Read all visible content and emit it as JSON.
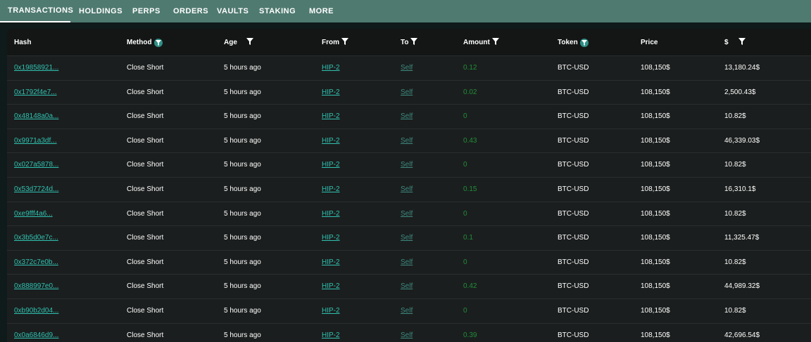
{
  "tabs": [
    {
      "label": "TRANSACTIONS",
      "active": true
    },
    {
      "label": "HOLDINGS",
      "active": false
    },
    {
      "label": "PERPS",
      "active": false
    },
    {
      "label": "ORDERS",
      "active": false
    },
    {
      "label": "VAULTS",
      "active": false
    },
    {
      "label": "STAKING",
      "active": false
    },
    {
      "label": "MORE",
      "active": false
    }
  ],
  "columns": {
    "hash": "Hash",
    "method": "Method",
    "age": "Age",
    "from": "From",
    "to": "To",
    "amount": "Amount",
    "token": "Token",
    "price": "Price",
    "usd": "$"
  },
  "rows": [
    {
      "hash": "0x19858921...",
      "method": "Close Short",
      "age": "5 hours ago",
      "from": "HIP-2",
      "to": "Self",
      "amount": "0.12",
      "token": "BTC-USD",
      "price": "108,150$",
      "usd": "13,180.24$"
    },
    {
      "hash": "0x1792f4e7...",
      "method": "Close Short",
      "age": "5 hours ago",
      "from": "HIP-2",
      "to": "Self",
      "amount": "0.02",
      "token": "BTC-USD",
      "price": "108,150$",
      "usd": "2,500.43$"
    },
    {
      "hash": "0x48148a0a...",
      "method": "Close Short",
      "age": "5 hours ago",
      "from": "HIP-2",
      "to": "Self",
      "amount": "0",
      "token": "BTC-USD",
      "price": "108,150$",
      "usd": "10.82$"
    },
    {
      "hash": "0x9971a3df...",
      "method": "Close Short",
      "age": "5 hours ago",
      "from": "HIP-2",
      "to": "Self",
      "amount": "0.43",
      "token": "BTC-USD",
      "price": "108,150$",
      "usd": "46,339.03$"
    },
    {
      "hash": "0x027a5878...",
      "method": "Close Short",
      "age": "5 hours ago",
      "from": "HIP-2",
      "to": "Self",
      "amount": "0",
      "token": "BTC-USD",
      "price": "108,150$",
      "usd": "10.82$"
    },
    {
      "hash": "0x53d7724d...",
      "method": "Close Short",
      "age": "5 hours ago",
      "from": "HIP-2",
      "to": "Self",
      "amount": "0.15",
      "token": "BTC-USD",
      "price": "108,150$",
      "usd": "16,310.1$"
    },
    {
      "hash": "0xe9fff4a6...",
      "method": "Close Short",
      "age": "5 hours ago",
      "from": "HIP-2",
      "to": "Self",
      "amount": "0",
      "token": "BTC-USD",
      "price": "108,150$",
      "usd": "10.82$"
    },
    {
      "hash": "0x3b5d0e7c...",
      "method": "Close Short",
      "age": "5 hours ago",
      "from": "HIP-2",
      "to": "Self",
      "amount": "0.1",
      "token": "BTC-USD",
      "price": "108,150$",
      "usd": "11,325.47$"
    },
    {
      "hash": "0x372c7e0b...",
      "method": "Close Short",
      "age": "5 hours ago",
      "from": "HIP-2",
      "to": "Self",
      "amount": "0",
      "token": "BTC-USD",
      "price": "108,150$",
      "usd": "10.82$"
    },
    {
      "hash": "0x888997e0...",
      "method": "Close Short",
      "age": "5 hours ago",
      "from": "HIP-2",
      "to": "Self",
      "amount": "0.42",
      "token": "BTC-USD",
      "price": "108,150$",
      "usd": "44,989.32$"
    },
    {
      "hash": "0xb90b2d04...",
      "method": "Close Short",
      "age": "5 hours ago",
      "from": "HIP-2",
      "to": "Self",
      "amount": "0",
      "token": "BTC-USD",
      "price": "108,150$",
      "usd": "10.82$"
    },
    {
      "hash": "0x0a6846d9...",
      "method": "Close Short",
      "age": "5 hours ago",
      "from": "HIP-2",
      "to": "Self",
      "amount": "0.39",
      "token": "BTC-USD",
      "price": "108,150$",
      "usd": "42,696.54$"
    }
  ],
  "icons": {
    "filter": "filter-icon"
  },
  "colors": {
    "nav_bg": "#4f7a70",
    "link": "#2fc2b2",
    "amount": "#1f8f3a"
  }
}
